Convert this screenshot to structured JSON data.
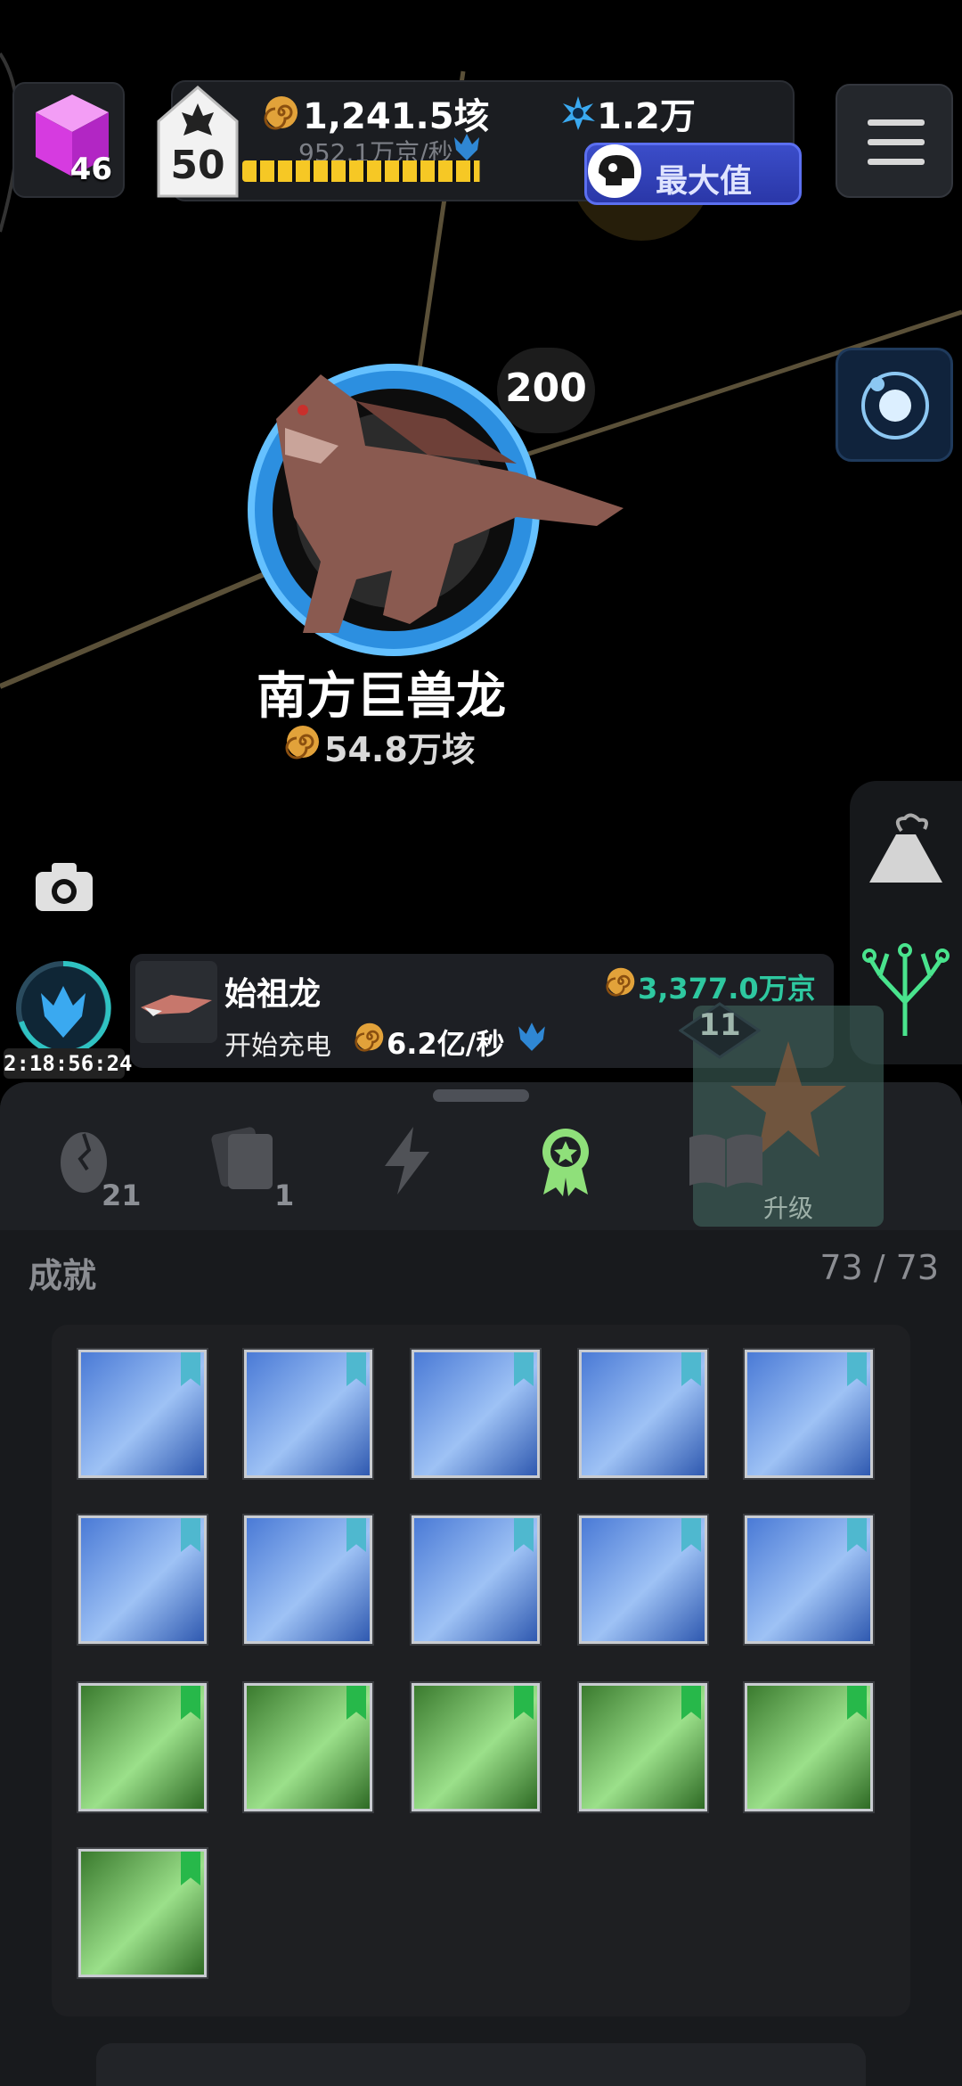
{
  "header": {
    "cube_count": "46",
    "level": "50",
    "amber_total": "1,241.5垓",
    "spark_total": "1.2万",
    "rate": "952.1万京/秒",
    "max_label": "最大值",
    "progress": 0.68
  },
  "dino": {
    "name": "南方巨兽龙",
    "cost": "54.8万垓",
    "level": "200"
  },
  "charging": {
    "timer": "2:18:56:24",
    "name": "始祖龙",
    "cost": "3,377.0万京",
    "label": "开始充电",
    "rate": "6.2亿/秒",
    "upgrade_level": "11",
    "upgrade_label": "升级"
  },
  "tabs": {
    "eggs_count": "21",
    "cards_count": "1"
  },
  "achievements": {
    "title": "成就",
    "count": "73 / 73",
    "tiles": [
      {
        "name": "dna",
        "tint": "blue"
      },
      {
        "name": "jellyfish",
        "tint": "blue"
      },
      {
        "name": "amphibian",
        "tint": "blue"
      },
      {
        "name": "rock",
        "tint": "blue"
      },
      {
        "name": "explorers",
        "tint": "blue"
      },
      {
        "name": "cyber-face",
        "tint": "blue"
      },
      {
        "name": "cyber-head",
        "tint": "blue"
      },
      {
        "name": "planet",
        "tint": "blue"
      },
      {
        "name": "whale",
        "tint": "blue"
      },
      {
        "name": "lion",
        "tint": "blue"
      },
      {
        "name": "skull",
        "tint": "green"
      },
      {
        "name": "comet",
        "tint": "green"
      },
      {
        "name": "t-rex-skeleton",
        "tint": "green"
      },
      {
        "name": "crocodile",
        "tint": "green"
      },
      {
        "name": "bird",
        "tint": "green"
      },
      {
        "name": "raptor",
        "tint": "green"
      }
    ]
  },
  "colors": {
    "accent_teal": "#2ec8a0",
    "accent_blue": "#3aa9f0",
    "active_tab": "#8fe07a",
    "progress_yellow": "#f4c21b"
  }
}
